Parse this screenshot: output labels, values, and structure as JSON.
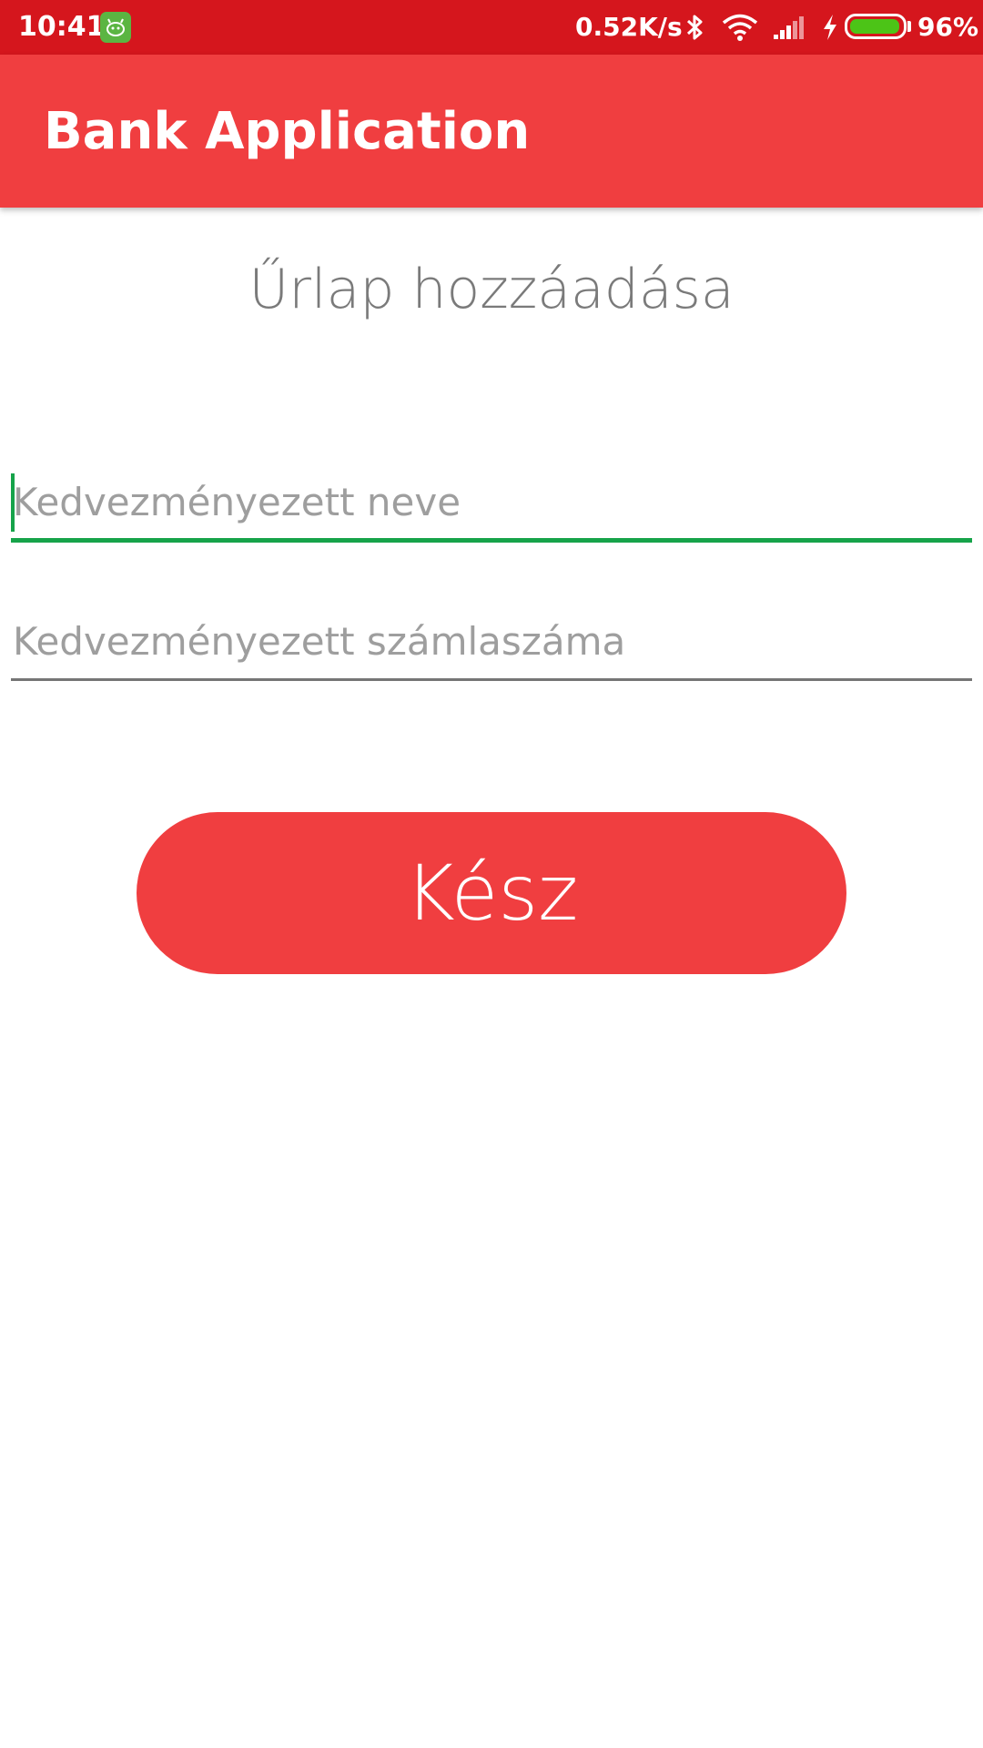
{
  "status_bar": {
    "time": "10:41",
    "network_speed": "0.52K/s",
    "battery_percent": "96%",
    "battery_level": 0.96,
    "icons": [
      "app-notification-icon",
      "bluetooth-icon",
      "wifi-icon",
      "cellular-signal-icon",
      "charging-bolt-icon",
      "battery-icon"
    ]
  },
  "app_bar": {
    "title": "Bank Application"
  },
  "form": {
    "title": "Űrlap hozzáadása",
    "beneficiary_name": {
      "value": "",
      "placeholder": "Kedvezményezett neve"
    },
    "beneficiary_account": {
      "value": "",
      "placeholder": "Kedvezményezett számlaszáma"
    },
    "submit_label": "Kész"
  },
  "colors": {
    "status_bar": "#d5161d",
    "primary": "#f03e40",
    "focus_accent": "#16a34a",
    "battery_fill": "#4cc417"
  }
}
